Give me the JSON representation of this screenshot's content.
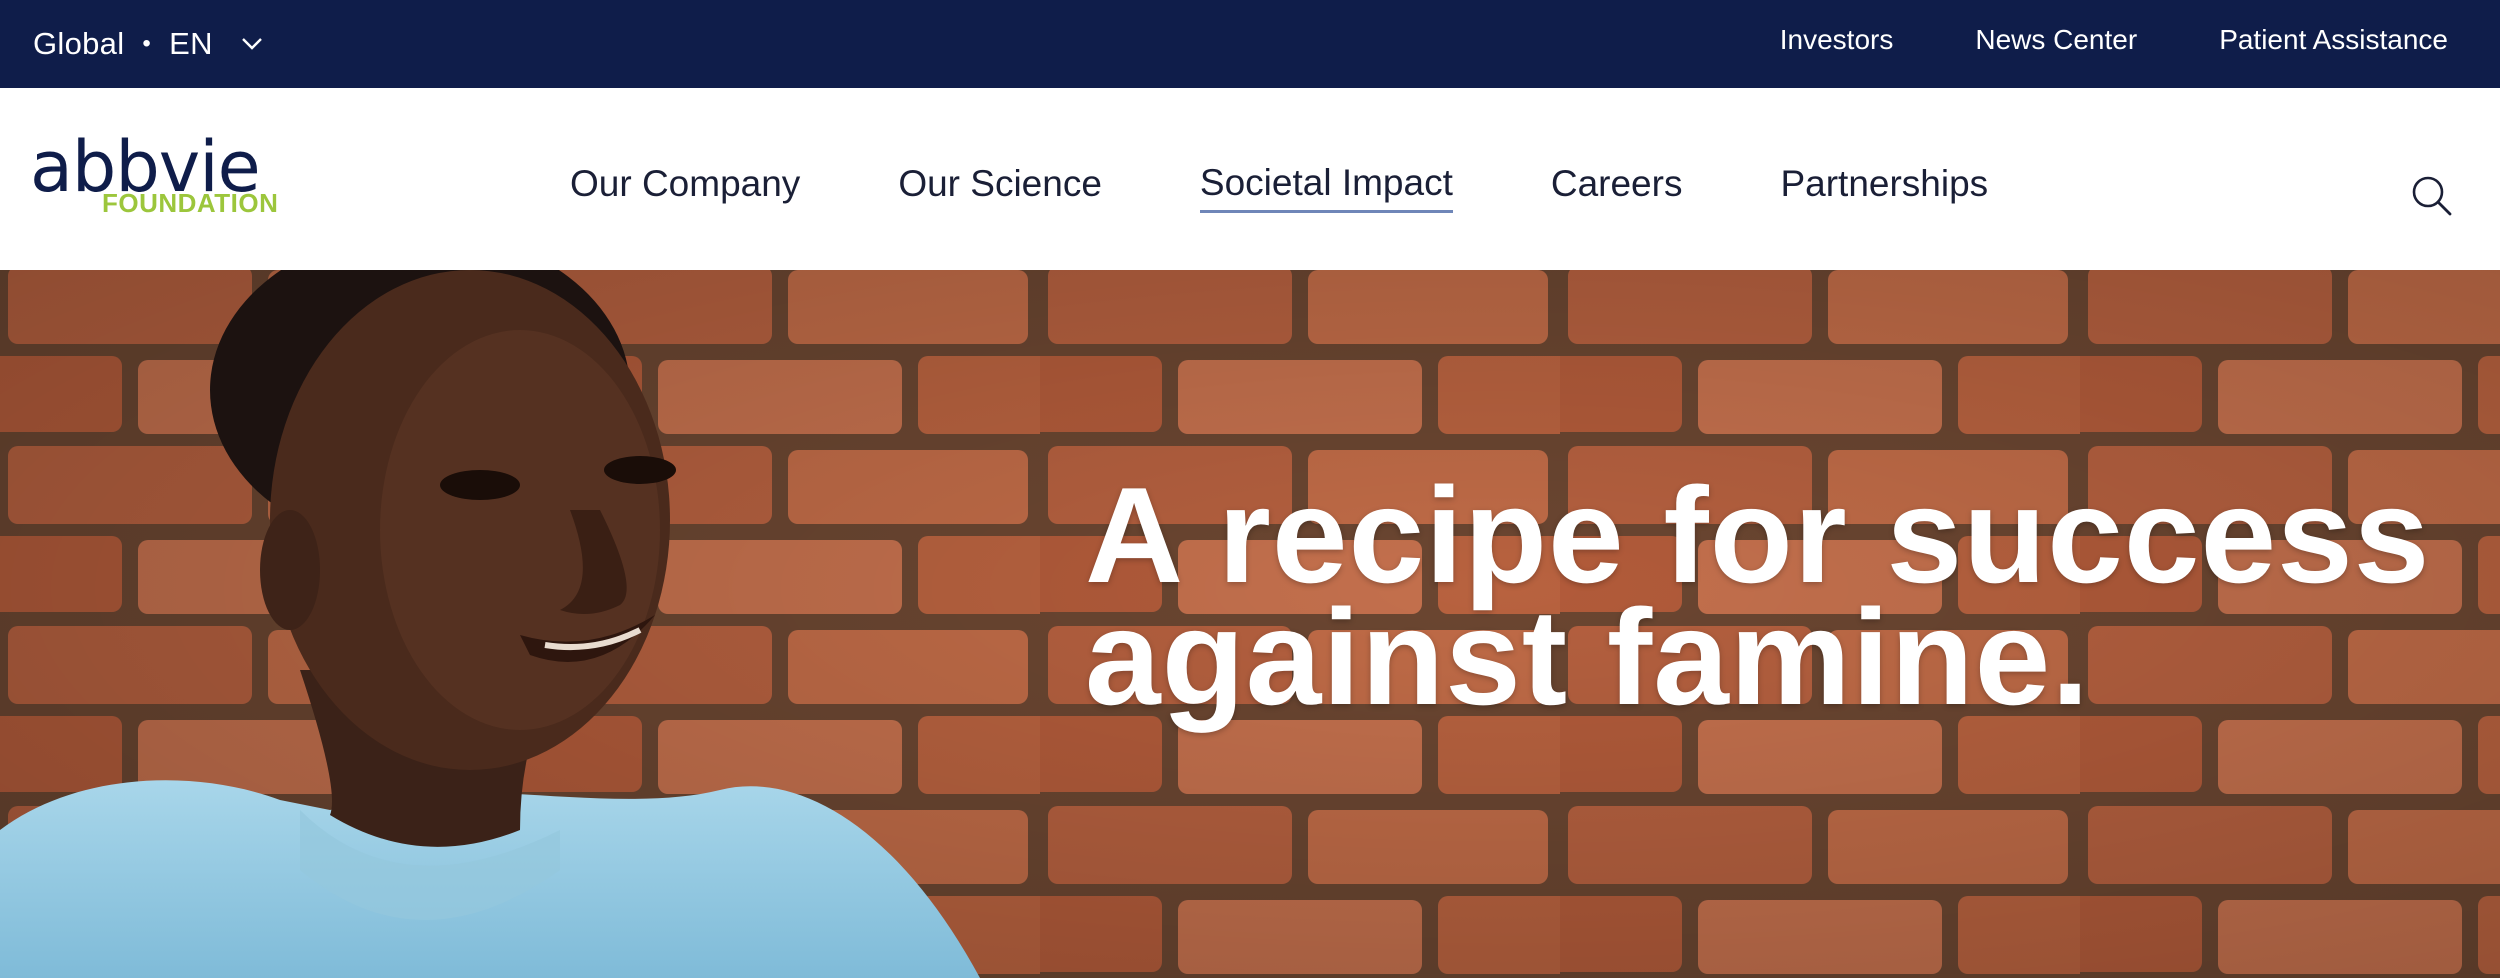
{
  "utility_bar": {
    "region_label": "Global",
    "separator": "•",
    "language_label": "EN",
    "links": [
      "Investors",
      "News Center",
      "Patient Assistance"
    ],
    "background_color": "#0f1d4a"
  },
  "header": {
    "logo": {
      "wordmark": "abbvie",
      "subtitle": "FOUNDATION",
      "wordmark_color": "#0f1d4a",
      "subtitle_color": "#9cc63c"
    },
    "nav": {
      "our_company": "Our Company",
      "our_science": "Our Science",
      "societal_impact": "Societal Impact",
      "careers": "Careers",
      "partnerships": "Partnerships"
    },
    "active_item": "Societal Impact",
    "icons": {
      "search": "search-icon",
      "language_menu": "chevron-down-icon"
    }
  },
  "hero": {
    "headline_line1": "A recipe for success",
    "headline_line2": "against famine.",
    "image": "portrait-of-smiling-girl-in-front-of-brick-wall"
  }
}
